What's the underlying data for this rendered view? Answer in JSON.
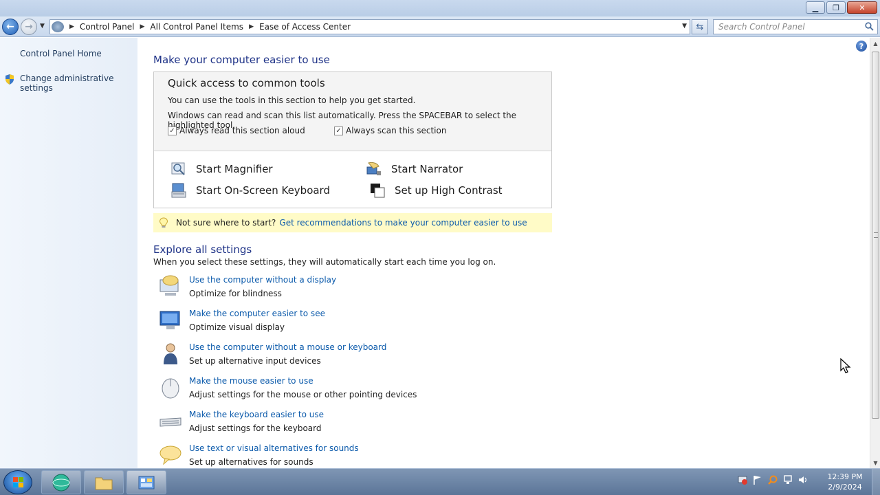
{
  "window": {
    "minimize_icon": "minimize-icon",
    "maximize_icon": "restore-icon",
    "close_icon": "close-icon"
  },
  "nav": {
    "breadcrumbs": [
      "Control Panel",
      "All Control Panel Items",
      "Ease of Access Center"
    ],
    "search_placeholder": "Search Control Panel"
  },
  "sidebar": {
    "home": "Control Panel Home",
    "admin": "Change administrative settings"
  },
  "main": {
    "heading": "Make your computer easier to use",
    "quick": {
      "title": "Quick access to common tools",
      "line1": "You can use the tools in this section to help you get started.",
      "line2": "Windows can read and scan this list automatically.  Press the SPACEBAR to select the highlighted tool.",
      "read_aloud": "Always read this section aloud",
      "read_aloud_checked": true,
      "scan": "Always scan this section",
      "scan_checked": true,
      "tools": [
        {
          "label": "Start Magnifier",
          "icon": "magnifier-icon"
        },
        {
          "label": "Start Narrator",
          "icon": "narrator-icon"
        },
        {
          "label": "Start On-Screen Keyboard",
          "icon": "keyboard-icon"
        },
        {
          "label": "Set up High Contrast",
          "icon": "high-contrast-icon"
        }
      ]
    },
    "tip": {
      "text": "Not sure where to start?",
      "link": "Get recommendations to make your computer easier to use"
    },
    "explore": {
      "heading": "Explore all settings",
      "description": "When you select these settings, they will automatically start each time you log on.",
      "items": [
        {
          "link": "Use the computer without a display",
          "desc": "Optimize for blindness",
          "icon": "display-off-icon"
        },
        {
          "link": "Make the computer easier to see",
          "desc": "Optimize visual display",
          "icon": "monitor-icon"
        },
        {
          "link": "Use the computer without a mouse or keyboard",
          "desc": "Set up alternative input devices",
          "icon": "person-icon"
        },
        {
          "link": "Make the mouse easier to use",
          "desc": "Adjust settings for the mouse or other pointing devices",
          "icon": "mouse-icon"
        },
        {
          "link": "Make the keyboard easier to use",
          "desc": "Adjust settings for the keyboard",
          "icon": "keyboard-icon"
        },
        {
          "link": "Use text or visual alternatives for sounds",
          "desc": "Set up alternatives for sounds",
          "icon": "speech-bubble-icon"
        }
      ]
    }
  },
  "taskbar": {
    "time": "12:39 PM",
    "date": "2/9/2024"
  },
  "colors": {
    "link": "#0b5aab",
    "heading": "#1e3287",
    "tip_bg": "#fffbc7"
  }
}
